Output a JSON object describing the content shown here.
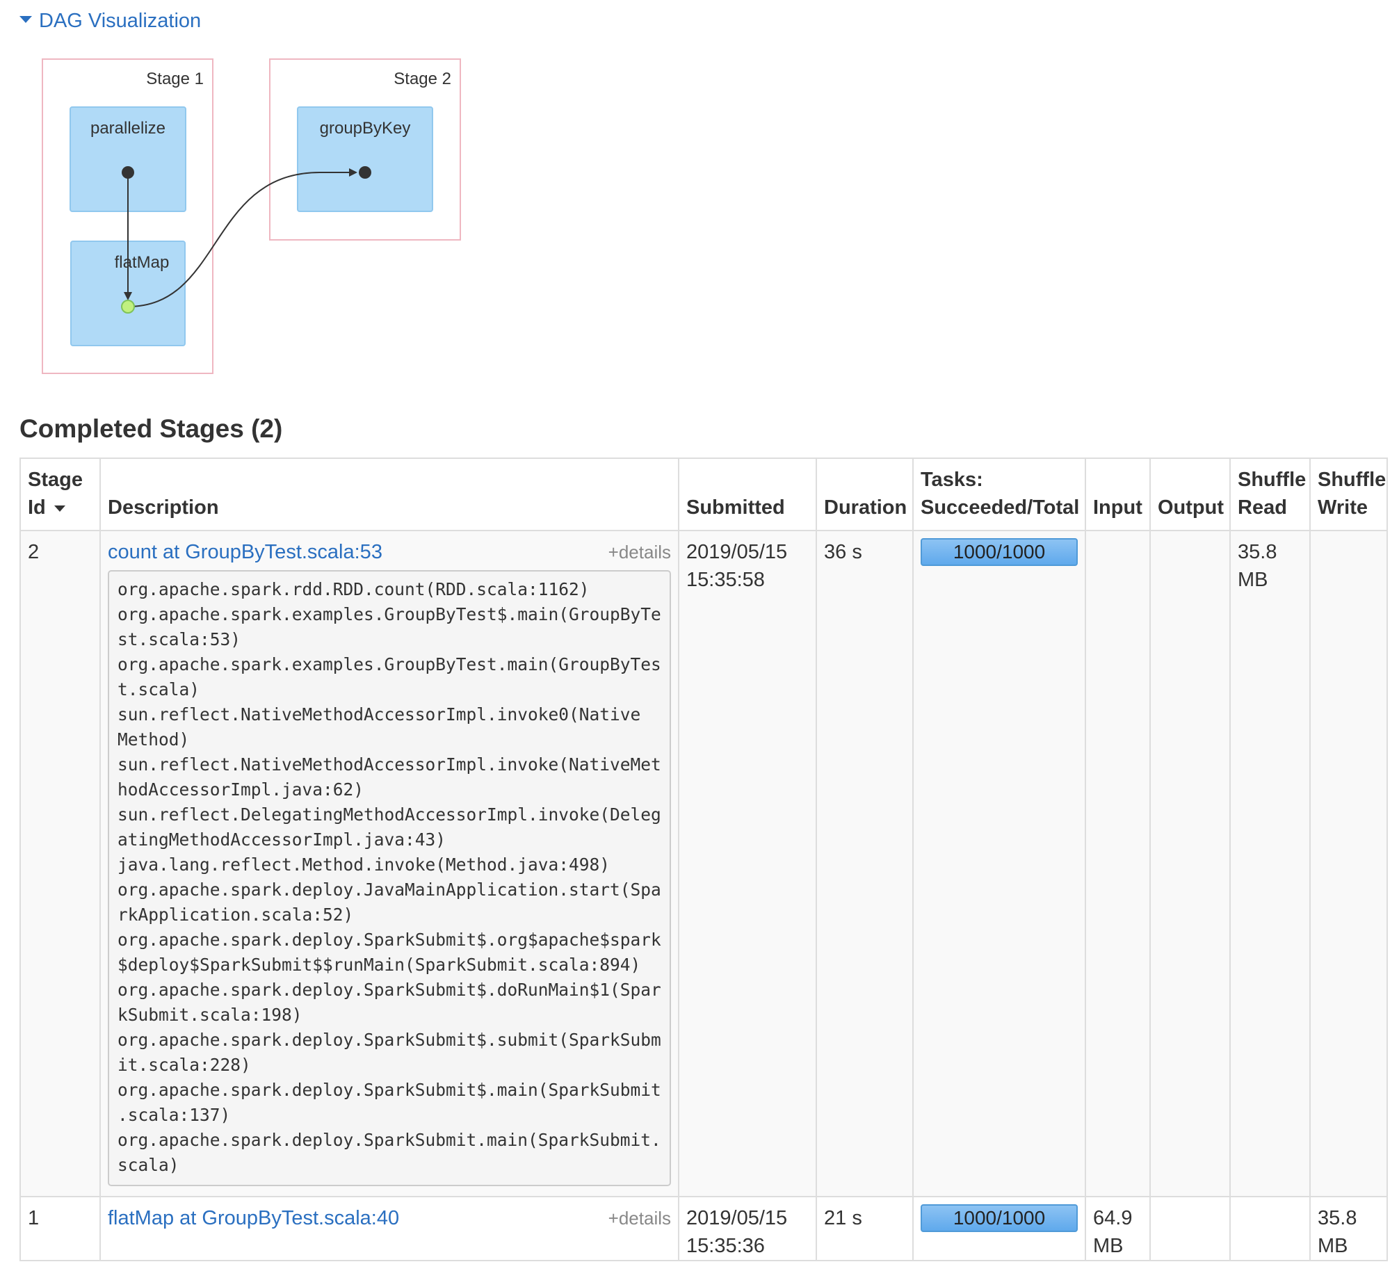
{
  "dag": {
    "toggle_label": "DAG Visualization",
    "stages": [
      {
        "label": "Stage 1",
        "operations": [
          "parallelize",
          "flatMap"
        ]
      },
      {
        "label": "Stage 2",
        "operations": [
          "groupByKey"
        ]
      }
    ]
  },
  "completed": {
    "title": "Completed Stages (2)",
    "headers": {
      "stage_id_line1": "Stage",
      "stage_id_line2": "Id",
      "description": "Description",
      "submitted": "Submitted",
      "duration": "Duration",
      "tasks_line1": "Tasks:",
      "tasks_line2": "Succeeded/Total",
      "input": "Input",
      "output": "Output",
      "shuffle_read_line1": "Shuffle",
      "shuffle_read_line2": "Read",
      "shuffle_write_line1": "Shuffle",
      "shuffle_write_line2": "Write"
    },
    "rows": [
      {
        "stage_id": "2",
        "description": "count at GroupByTest.scala:53",
        "details_label": "+details",
        "stack_trace": "org.apache.spark.rdd.RDD.count(RDD.scala:1162)\norg.apache.spark.examples.GroupByTest$.main(GroupByTe\nst.scala:53)\norg.apache.spark.examples.GroupByTest.main(GroupByTes\nt.scala)\nsun.reflect.NativeMethodAccessorImpl.invoke0(Native\nMethod)\nsun.reflect.NativeMethodAccessorImpl.invoke(NativeMet\nhodAccessorImpl.java:62)\nsun.reflect.DelegatingMethodAccessorImpl.invoke(Deleg\natingMethodAccessorImpl.java:43)\njava.lang.reflect.Method.invoke(Method.java:498)\norg.apache.spark.deploy.JavaMainApplication.start(Spa\nrkApplication.scala:52)\norg.apache.spark.deploy.SparkSubmit$.org$apache$spark\n$deploy$SparkSubmit$$runMain(SparkSubmit.scala:894)\norg.apache.spark.deploy.SparkSubmit$.doRunMain$1(Spar\nkSubmit.scala:198)\norg.apache.spark.deploy.SparkSubmit$.submit(SparkSubm\nit.scala:228)\norg.apache.spark.deploy.SparkSubmit$.main(SparkSubmit\n.scala:137)\norg.apache.spark.deploy.SparkSubmit.main(SparkSubmit.\nscala)",
        "submitted_date": "2019/05/15",
        "submitted_time": "15:35:58",
        "duration": "36 s",
        "tasks": "1000/1000",
        "tasks_fraction": 1.0,
        "input_value": "",
        "input_unit": "",
        "output": "",
        "shuffle_read_value": "35.8",
        "shuffle_read_unit": "MB",
        "shuffle_write_value": "",
        "shuffle_write_unit": ""
      },
      {
        "stage_id": "1",
        "description": "flatMap at GroupByTest.scala:40",
        "details_label": "+details",
        "submitted_date": "2019/05/15",
        "submitted_time": "15:35:36",
        "duration": "21 s",
        "tasks": "1000/1000",
        "tasks_fraction": 1.0,
        "input_value": "64.9",
        "input_unit": "MB",
        "output": "",
        "shuffle_read_value": "",
        "shuffle_read_unit": "",
        "shuffle_write_value": "35.8",
        "shuffle_write_unit": "MB"
      }
    ]
  }
}
